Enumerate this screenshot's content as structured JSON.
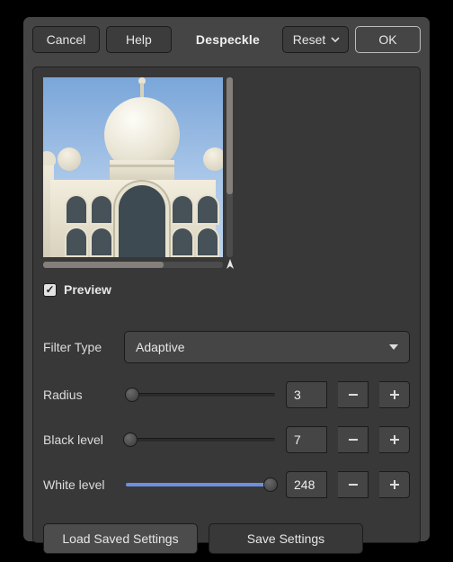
{
  "header": {
    "cancel": "Cancel",
    "help": "Help",
    "title": "Despeckle",
    "reset": "Reset",
    "ok": "OK"
  },
  "preview": {
    "checkbox_label": "Preview",
    "checked": true
  },
  "filter": {
    "label": "Filter Type",
    "value": "Adaptive"
  },
  "sliders": {
    "radius": {
      "label": "Radius",
      "value": "3",
      "min": 1,
      "max": 100,
      "frac": 0.04
    },
    "black": {
      "label": "Black level",
      "value": "7",
      "min": 0,
      "max": 255,
      "frac": 0.03
    },
    "white": {
      "label": "White level",
      "value": "248",
      "min": 0,
      "max": 255,
      "frac": 0.972
    }
  },
  "footer": {
    "load": "Load Saved Settings",
    "save": "Save Settings"
  }
}
